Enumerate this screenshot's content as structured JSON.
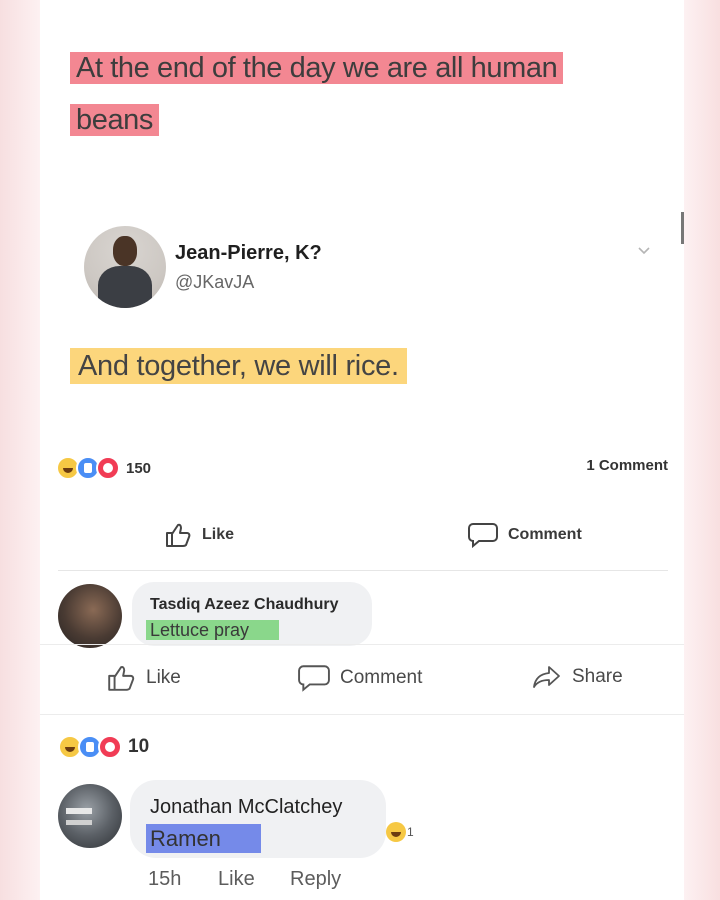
{
  "quote": {
    "line1": "At the end of the day we are all human",
    "line2": "beans"
  },
  "tweet": {
    "author_name": "Jean-Pierre, K?",
    "author_handle": "@JKavJA",
    "text": "And together, we will rice."
  },
  "post_stats": {
    "reaction_count": "150",
    "comment_count": "1 Comment",
    "reactions": [
      "haha",
      "like",
      "love"
    ]
  },
  "post_actions": {
    "like_label": "Like",
    "comment_label": "Comment"
  },
  "comment1": {
    "author": "Tasdiq Azeez Chaudhury",
    "text": "Lettuce pray"
  },
  "actions": {
    "like_label": "Like",
    "comment_label": "Comment",
    "share_label": "Share"
  },
  "comment_stats": {
    "reaction_count": "10"
  },
  "comment2": {
    "author": "Jonathan McClatchey",
    "text": "Ramen",
    "reaction_count": "1",
    "time": "15h",
    "like_label": "Like",
    "reply_label": "Reply"
  },
  "colors": {
    "highlight_pink": "#f06c7a",
    "highlight_yellow": "#fcd26e",
    "highlight_green": "#78d278",
    "highlight_blue": "#5f78e6"
  },
  "icons": [
    "chevron-down-icon",
    "thumbs-up-icon",
    "comment-bubble-icon",
    "share-arrow-icon",
    "haha-reaction-icon",
    "like-reaction-icon",
    "love-reaction-icon"
  ]
}
